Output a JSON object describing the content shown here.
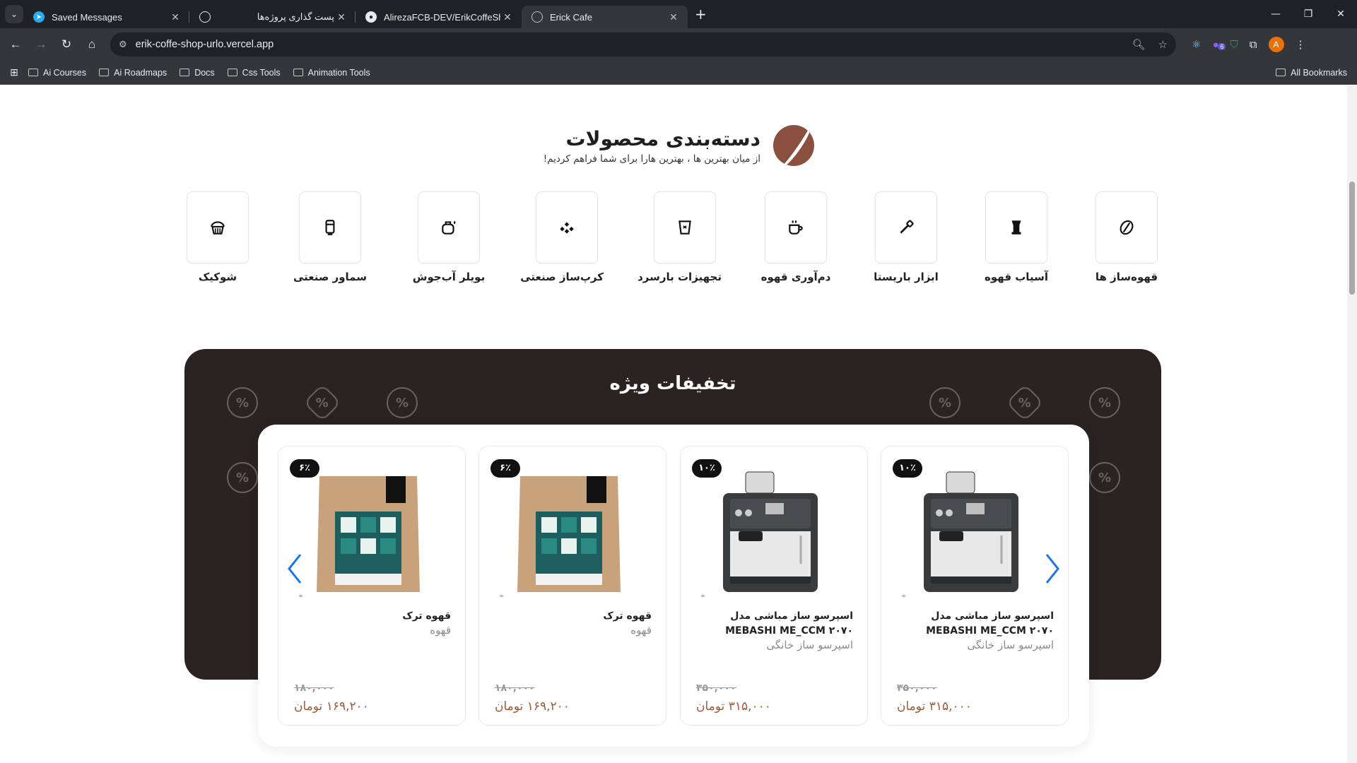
{
  "browser": {
    "tabs": [
      {
        "title": "Saved Messages",
        "icon": "telegram-icon",
        "active": false
      },
      {
        "title": "پست گذاری پروژه‌ها",
        "icon": "chatgpt-icon",
        "active": false
      },
      {
        "title": "AlirezaFCB-DEV/ErikCoffeShop",
        "icon": "github-icon",
        "active": false
      },
      {
        "title": "Erick Cafe",
        "icon": "globe-icon",
        "active": true
      }
    ],
    "url": "erik-coffe-shop-urlo.vercel.app",
    "extension_badge": "6",
    "avatar_letter": "A",
    "bookmarks": [
      "Ai Courses",
      "Ai Roadmaps",
      "Docs",
      "Css Tools",
      "Animation Tools"
    ],
    "all_bookmarks": "All Bookmarks"
  },
  "section": {
    "title": "دسته‌بندی محصولات",
    "subtitle": "از میان بهترین ها ، بهترین هارا برای شما فراهم کردیم!"
  },
  "categories": [
    {
      "label": "قهوه‌ساز ها",
      "icon": "coffee-bean-icon"
    },
    {
      "label": "آسیاب قهوه",
      "icon": "grinder-icon"
    },
    {
      "label": "ابزار باریستا",
      "icon": "barista-tool-icon"
    },
    {
      "label": "دم‌آوری قهوه",
      "icon": "brew-cup-icon"
    },
    {
      "label": "تجهیزات بارسرد",
      "icon": "cold-bar-cup-icon"
    },
    {
      "label": "کرپ‌ساز صنعتی",
      "icon": "crepe-maker-icon"
    },
    {
      "label": "بویلر آب‌جوش",
      "icon": "boiler-icon"
    },
    {
      "label": "سماور صنعتی",
      "icon": "samovar-icon"
    },
    {
      "label": "شوکیک",
      "icon": "cupcake-icon"
    }
  ],
  "offers": {
    "title": "تخفیفات ویژه",
    "products": [
      {
        "name": "اسپرسو ساز مباشی مدل MEBASHI ME_CCM ۲۰۷۰",
        "category": "اسپرسو ساز خانگی",
        "discount": "۱۰٪",
        "old_price": "۳۵۰,۰۰۰",
        "new_price": "۳۱۵,۰۰۰ تومان",
        "image": "espresso-machine-image"
      },
      {
        "name": "اسپرسو ساز مباشی مدل MEBASHI ME_CCM ۲۰۷۰",
        "category": "اسپرسو ساز خانگی",
        "discount": "۱۰٪",
        "old_price": "۳۵۰,۰۰۰",
        "new_price": "۳۱۵,۰۰۰ تومان",
        "image": "espresso-machine-image"
      },
      {
        "name": "قهوه ترک",
        "category": "قهوه",
        "discount": "۶٪",
        "old_price": "۱۸۰,۰۰۰",
        "new_price": "۱۶۹,۲۰۰ تومان",
        "image": "coffee-bag-image"
      },
      {
        "name": "قهوه ترک",
        "category": "قهوه",
        "discount": "۶٪",
        "old_price": "۱۸۰,۰۰۰",
        "new_price": "۱۶۹,۲۰۰ تومان",
        "image": "coffee-bag-image"
      }
    ]
  },
  "colors": {
    "accent_brown": "#8b4f3f",
    "price_brown": "#9c5a3c",
    "offers_bg": "#2a2321",
    "slider_arrow": "#1a73e8"
  }
}
